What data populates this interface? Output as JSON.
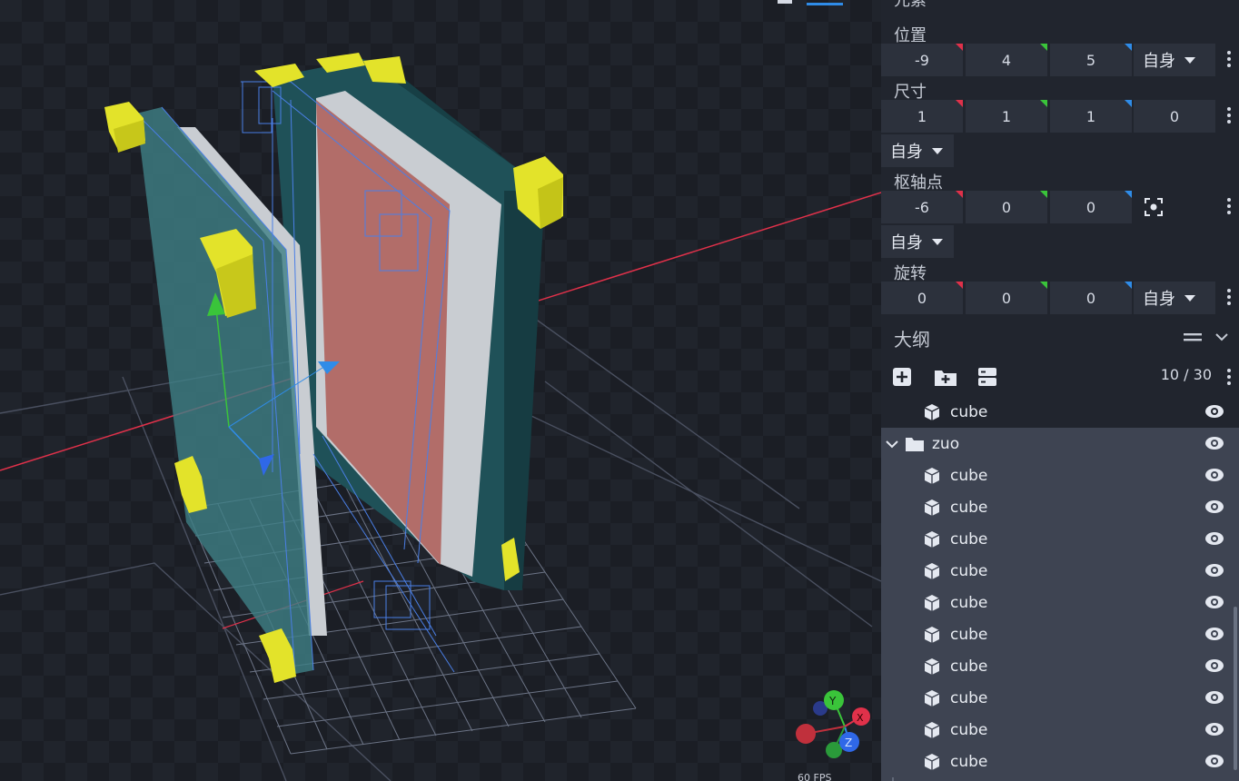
{
  "viewport": {
    "fps_text": "60 FPS",
    "gizmo_axes": {
      "x": "X",
      "y": "Y",
      "z": "Z"
    }
  },
  "panel": {
    "section_title": "元素",
    "position": {
      "label": "位置",
      "x": "-9",
      "y": "4",
      "z": "5",
      "space": "自身"
    },
    "size": {
      "label": "尺寸",
      "x": "1",
      "y": "1",
      "z": "1",
      "inflate": "0",
      "space": "自身"
    },
    "pivot": {
      "label": "枢轴点",
      "x": "-6",
      "y": "0",
      "z": "0",
      "space": "自身"
    },
    "rotation": {
      "label": "旋转",
      "x": "0",
      "y": "0",
      "z": "0",
      "space": "自身"
    },
    "outline": {
      "title": "大纲",
      "count": "10 / 30",
      "top_item": "cube",
      "folder": "zuo",
      "children": [
        "cube",
        "cube",
        "cube",
        "cube",
        "cube",
        "cube",
        "cube",
        "cube",
        "cube",
        "cube"
      ]
    }
  },
  "colors": {
    "red_axis": "#e0314a",
    "green_axis": "#3ac43a",
    "blue_axis": "#2f8ce8",
    "selected_row": "#3e4452"
  }
}
